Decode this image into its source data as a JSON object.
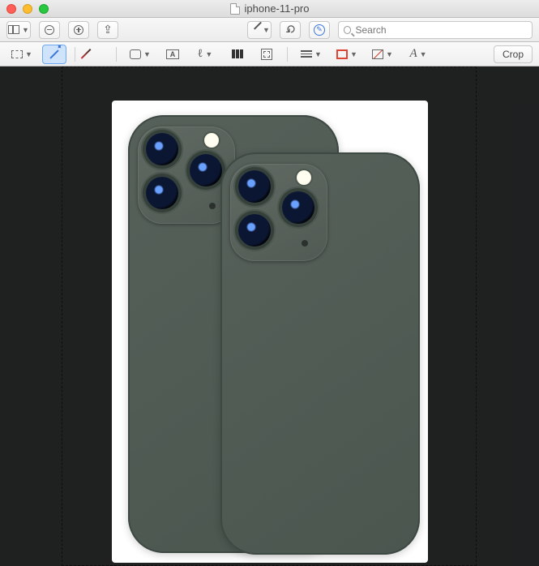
{
  "window": {
    "title": "iphone-11-pro"
  },
  "toolbar": {
    "search_placeholder": "Search"
  },
  "markup": {
    "text_glyph": "A",
    "font_glyph": "A",
    "crop_label": "Crop"
  }
}
